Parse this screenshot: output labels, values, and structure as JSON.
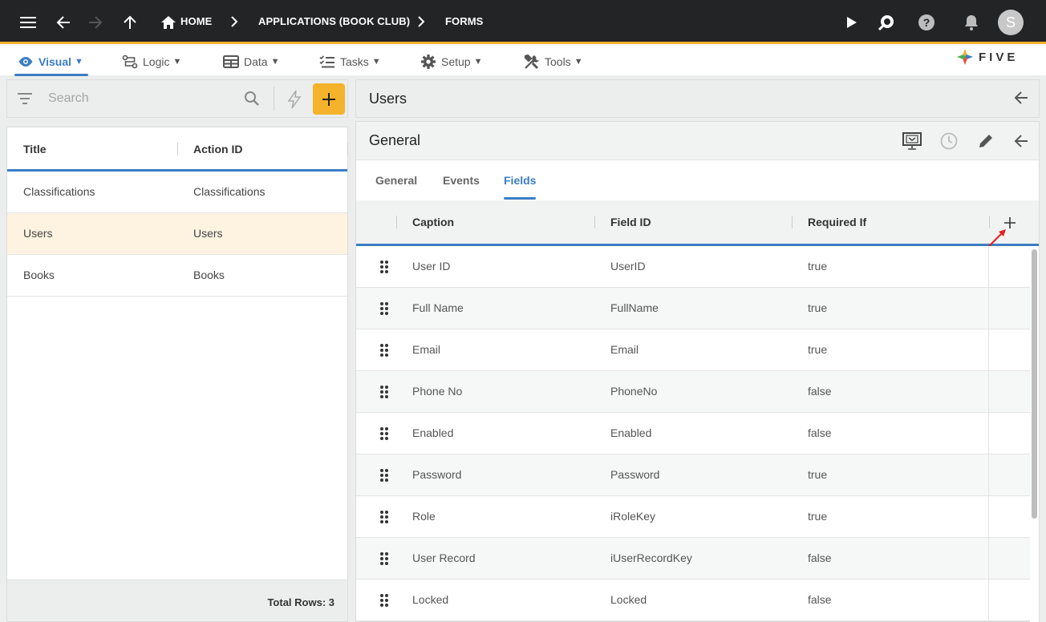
{
  "topbar": {
    "breadcrumbs": [
      "HOME",
      "APPLICATIONS (BOOK CLUB)",
      "FORMS"
    ],
    "avatar_letter": "S",
    "accent": "#f5b22b"
  },
  "menubar": {
    "items": [
      {
        "label": "Visual",
        "icon": "eye-icon",
        "active": true
      },
      {
        "label": "Logic",
        "icon": "flow-icon"
      },
      {
        "label": "Data",
        "icon": "table-icon"
      },
      {
        "label": "Tasks",
        "icon": "checklist-icon"
      },
      {
        "label": "Setup",
        "icon": "gear-icon"
      },
      {
        "label": "Tools",
        "icon": "tools-icon"
      }
    ],
    "caret": "▼",
    "logo_text": "FIVE"
  },
  "left": {
    "search_placeholder": "Search",
    "columns": [
      "Title",
      "Action ID"
    ],
    "rows": [
      {
        "title": "Classifications",
        "action_id": "Classifications"
      },
      {
        "title": "Users",
        "action_id": "Users",
        "selected": true
      },
      {
        "title": "Books",
        "action_id": "Books"
      }
    ],
    "footer": "Total Rows: 3"
  },
  "right": {
    "title": "Users",
    "form_title": "General",
    "tabs": [
      "General",
      "Events",
      "Fields"
    ],
    "active_tab": "Fields",
    "grid_columns": [
      "Caption",
      "Field ID",
      "Required If"
    ],
    "rows": [
      {
        "caption": "User ID",
        "field_id": "UserID",
        "required_if": "true"
      },
      {
        "caption": "Full Name",
        "field_id": "FullName",
        "required_if": "true"
      },
      {
        "caption": "Email",
        "field_id": "Email",
        "required_if": "true"
      },
      {
        "caption": "Phone No",
        "field_id": "PhoneNo",
        "required_if": "false"
      },
      {
        "caption": "Enabled",
        "field_id": "Enabled",
        "required_if": "false"
      },
      {
        "caption": "Password",
        "field_id": "Password",
        "required_if": "true"
      },
      {
        "caption": "Role",
        "field_id": "iRoleKey",
        "required_if": "true"
      },
      {
        "caption": "User Record",
        "field_id": "iUserRecordKey",
        "required_if": "false"
      },
      {
        "caption": "Locked",
        "field_id": "Locked",
        "required_if": "false"
      }
    ]
  },
  "colors": {
    "primary": "#3b7dc4",
    "accent": "#f5b22b",
    "annotation": "#e02020"
  }
}
